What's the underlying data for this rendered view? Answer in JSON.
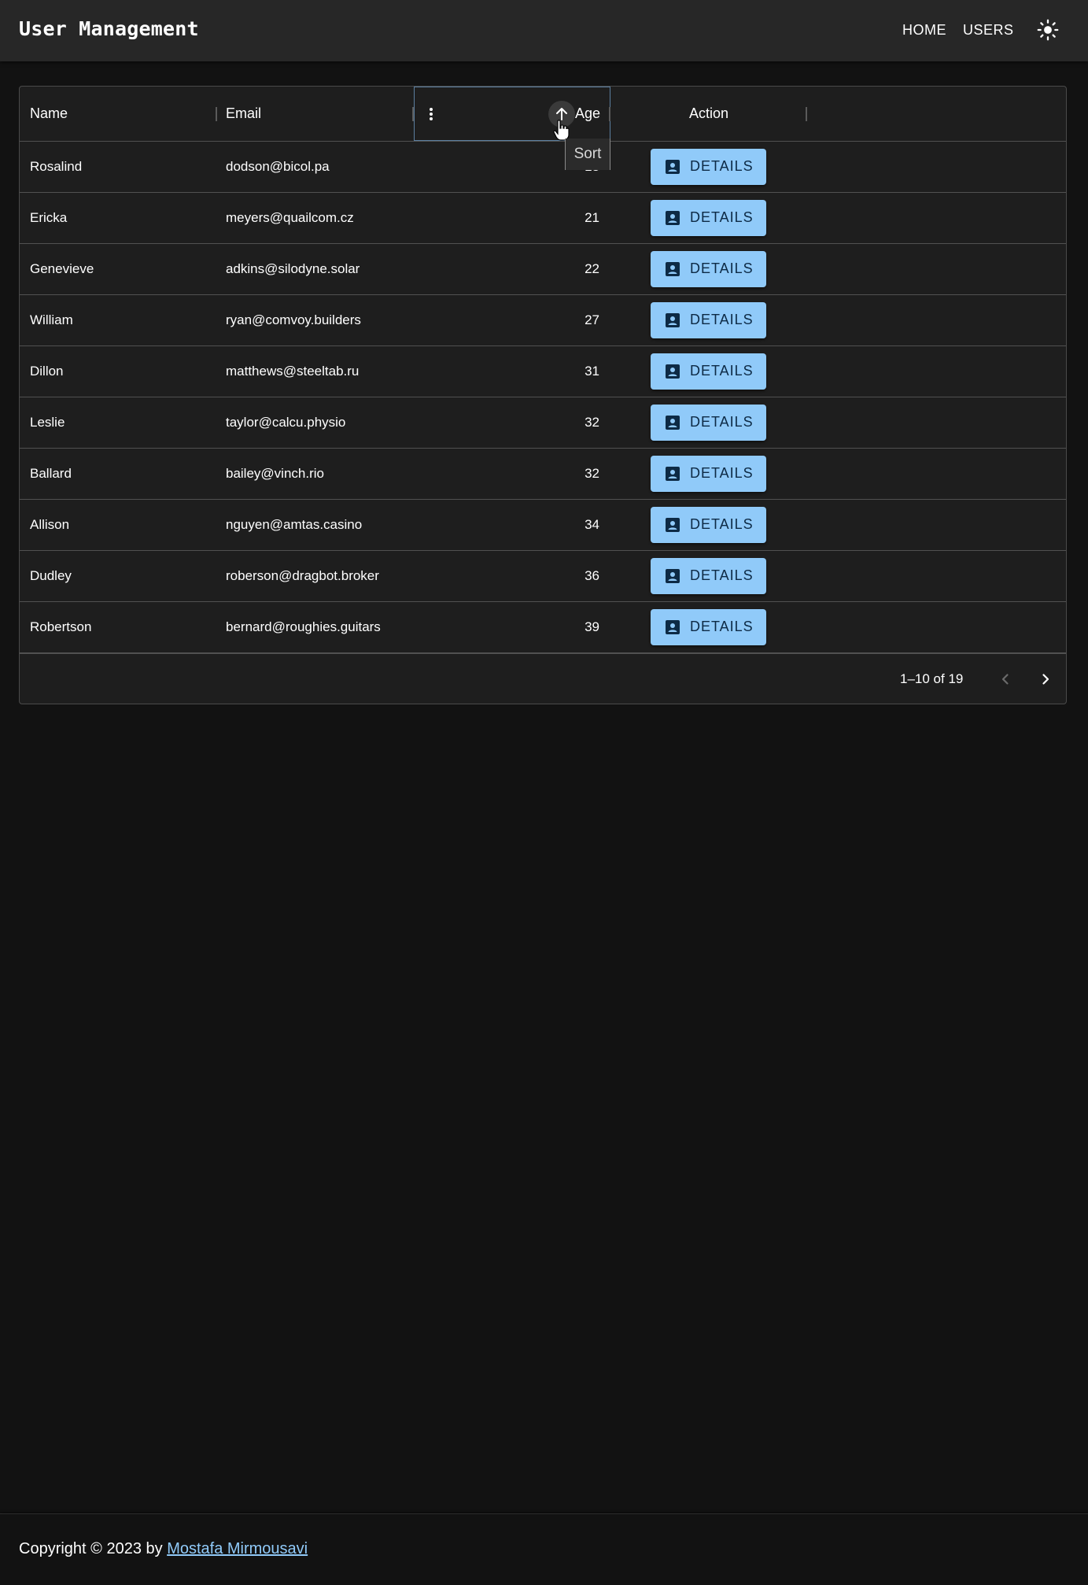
{
  "app": {
    "title": "User Management"
  },
  "nav": {
    "home": "HOME",
    "users": "USERS",
    "theme_icon": "sun-icon"
  },
  "grid": {
    "columns": {
      "name": "Name",
      "email": "Email",
      "age": "Age",
      "action": "Action"
    },
    "sort_tooltip": "Sort",
    "rows": [
      {
        "name": "Rosalind",
        "email": "dodson@bicol.pa",
        "age": "18",
        "action": "DETAILS"
      },
      {
        "name": "Ericka",
        "email": "meyers@quailcom.cz",
        "age": "21",
        "action": "DETAILS"
      },
      {
        "name": "Genevieve",
        "email": "adkins@silodyne.solar",
        "age": "22",
        "action": "DETAILS"
      },
      {
        "name": "William",
        "email": "ryan@comvoy.builders",
        "age": "27",
        "action": "DETAILS"
      },
      {
        "name": "Dillon",
        "email": "matthews@steeltab.ru",
        "age": "31",
        "action": "DETAILS"
      },
      {
        "name": "Leslie",
        "email": "taylor@calcu.physio",
        "age": "32",
        "action": "DETAILS"
      },
      {
        "name": "Ballard",
        "email": "bailey@vinch.rio",
        "age": "32",
        "action": "DETAILS"
      },
      {
        "name": "Allison",
        "email": "nguyen@amtas.casino",
        "age": "34",
        "action": "DETAILS"
      },
      {
        "name": "Dudley",
        "email": "roberson@dragbot.broker",
        "age": "36",
        "action": "DETAILS"
      },
      {
        "name": "Robertson",
        "email": "bernard@roughies.guitars",
        "age": "39",
        "action": "DETAILS"
      }
    ],
    "pagination": {
      "label": "1–10 of 19"
    }
  },
  "footer": {
    "prefix": "Copyright © 2023 by ",
    "author": "Mostafa Mirmousavi"
  },
  "colors": {
    "background": "#121212",
    "appbar": "#272727",
    "accent": "#90caf9"
  }
}
